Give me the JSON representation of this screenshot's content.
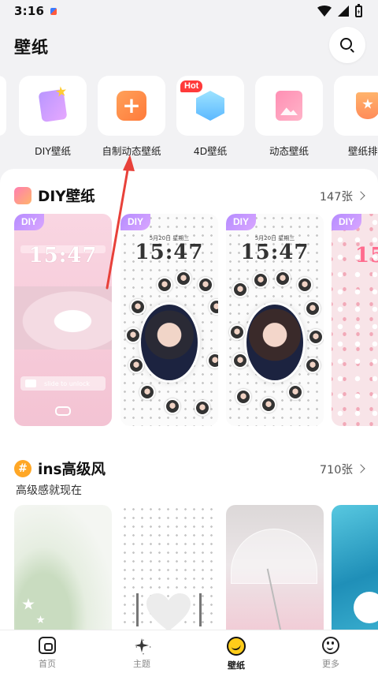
{
  "status_bar": {
    "time": "3:16"
  },
  "header": {
    "title": "壁纸",
    "search_icon": "search-icon"
  },
  "categories": [
    {
      "label": "DIY壁纸",
      "icon": "magic-card-icon"
    },
    {
      "label": "自制动态壁纸",
      "icon": "plus-icon"
    },
    {
      "label": "4D壁纸",
      "icon": "cube-icon",
      "badge": "Hot"
    },
    {
      "label": "动态壁纸",
      "icon": "photo-cards-icon"
    },
    {
      "label": "壁纸排行",
      "icon": "trophy-icon"
    }
  ],
  "sections": {
    "diy": {
      "title": "DIY壁纸",
      "count": "147张",
      "tiles": [
        {
          "badge": "DIY",
          "time": "15:47",
          "slide_text": "slide to unlock"
        },
        {
          "badge": "DIY",
          "date": "5月20日 星期三",
          "time": "15:47"
        },
        {
          "badge": "DIY",
          "date": "5月20日 星期三",
          "time": "15:47"
        },
        {
          "badge": "DIY",
          "time": "15"
        }
      ]
    },
    "ins": {
      "title": "ins高级风",
      "count": "710张",
      "subtitle": "高级感就现在"
    }
  },
  "bottom_nav": [
    {
      "label": "首页",
      "icon": "home-icon",
      "active": false
    },
    {
      "label": "主题",
      "icon": "theme-icon",
      "active": false
    },
    {
      "label": "壁纸",
      "icon": "wallpaper-icon",
      "active": true
    },
    {
      "label": "更多",
      "icon": "more-icon",
      "active": false
    }
  ],
  "colors": {
    "accent_orange": "#ff8c45",
    "diy_badge": "#b58cff",
    "hot_badge": "#ff3a3a",
    "annotation_arrow": "#e8413a"
  }
}
